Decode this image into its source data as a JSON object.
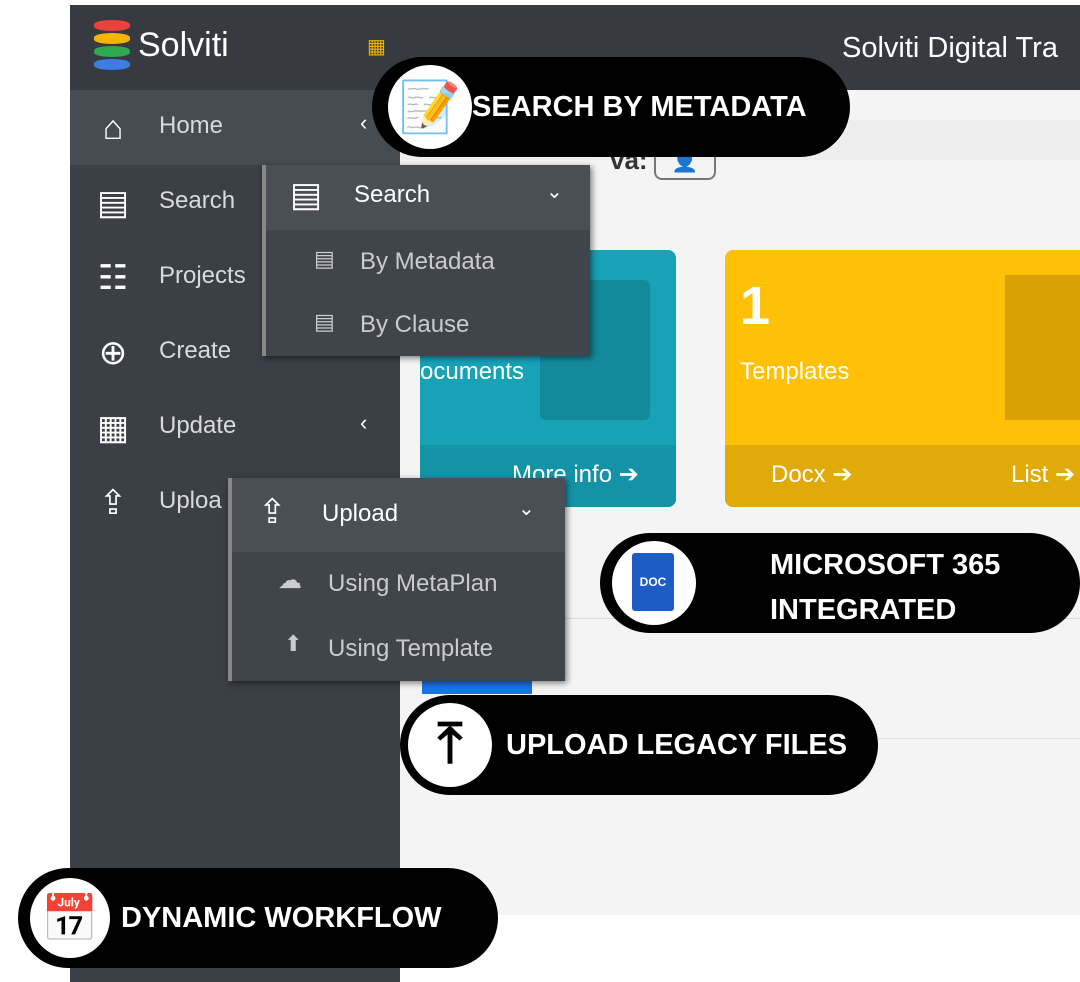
{
  "brand": {
    "name": "Solviti",
    "app_title": "Solviti Digital Tra"
  },
  "sidebar": {
    "items": [
      {
        "label": "Home",
        "icon": "home-icon",
        "chevron": "‹"
      },
      {
        "label": "Search",
        "icon": "search-doc-icon"
      },
      {
        "label": "Projects",
        "icon": "projects-icon"
      },
      {
        "label": "Create",
        "icon": "create-doc-icon"
      },
      {
        "label": "Update",
        "icon": "update-icon",
        "chevron": "‹"
      },
      {
        "label": "Uploa",
        "icon": "upload-icon"
      }
    ]
  },
  "search_menu": {
    "title": "Search",
    "items": [
      "By Metadata",
      "By Clause"
    ]
  },
  "upload_menu": {
    "title": "Upload",
    "items": [
      "Using MetaPlan",
      "Using Template"
    ]
  },
  "main": {
    "welcome_partial": "va:",
    "cards": [
      {
        "label": "ocuments",
        "link": "More info",
        "color": "#17a2b8"
      },
      {
        "count": "1",
        "label": "Templates",
        "links": [
          "Docx",
          "List"
        ],
        "color": "#ffc107"
      }
    ]
  },
  "callouts": [
    "SEARCH BY METADATA",
    "MICROSOFT 365 INTEGRATED",
    "UPLOAD LEGACY FILES",
    "DYNAMIC WORKFLOW"
  ],
  "doc_icon_text": "DOC"
}
